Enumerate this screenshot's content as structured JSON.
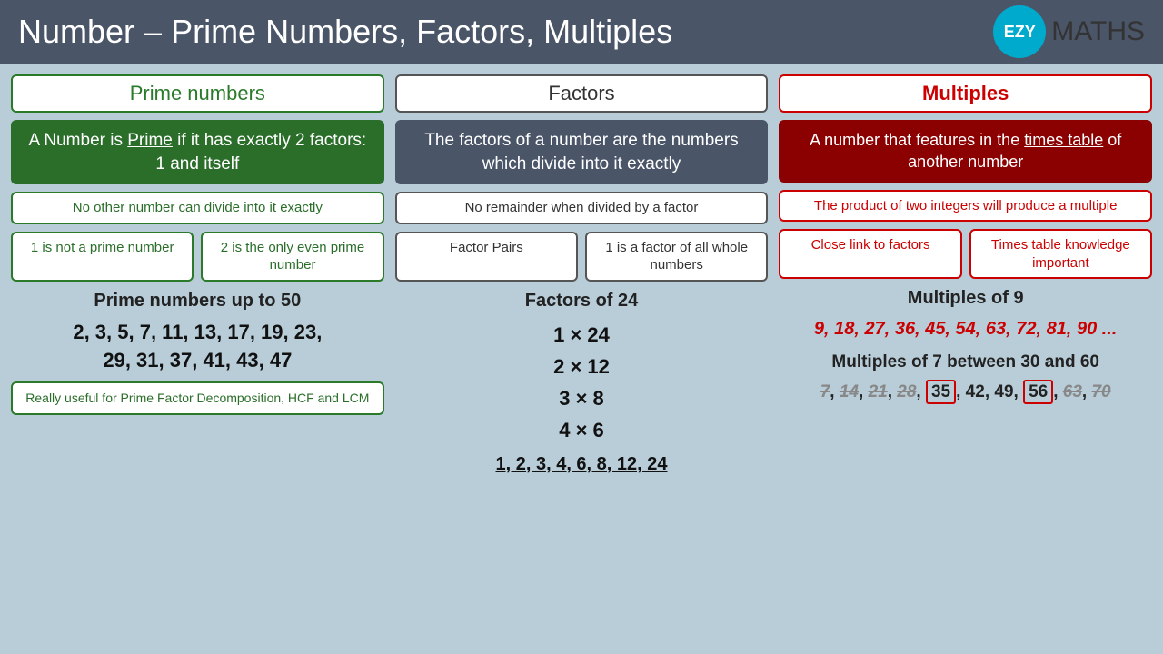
{
  "header": {
    "title": "Number – Prime Numbers, Factors, Multiples",
    "logo_text": "EZY",
    "logo_suffix": "MATHS"
  },
  "prime": {
    "section_title": "Prime numbers",
    "definition": "A Number is Prime if it has exactly 2 factors: 1 and itself",
    "sub_info": "No other number can divide into it exactly",
    "sub1_label": "1 is not a prime number",
    "sub2_label": "2 is the only even prime number",
    "list_label": "Prime numbers up to 50",
    "list": "2, 3, 5, 7, 11, 13, 17, 19, 23, 29, 31, 37, 41, 43, 47",
    "note": "Really useful for Prime Factor Decomposition, HCF and LCM"
  },
  "factors": {
    "section_title": "Factors",
    "definition": "The factors of a number are the numbers which divide into it exactly",
    "sub_info": "No remainder when divided by a factor",
    "sub1_label": "Factor Pairs",
    "sub2_label": "1 is a factor of all whole numbers",
    "list_label": "Factors of 24",
    "pairs": [
      "1 × 24",
      "2 × 12",
      "3 × 8",
      "4 × 6"
    ],
    "all_factors": "1, 2, 3, 4, 6, 8, 12, 24"
  },
  "multiples": {
    "section_title": "Multiples",
    "definition": "A number that features in the times table of another number",
    "sub_info": "The product of two integers will produce a multiple",
    "sub1_label": "Close link to factors",
    "sub2_label": "Times table knowledge important",
    "list_label": "Multiples of 9",
    "list": "9, 18, 27, 36, 45, 54, 63, 72, 81, 90 ...",
    "list2_label": "Multiples of 7 between 30 and 60",
    "list2": "7, 14, 21, 28, 35, 42, 49, 56, 63, 70"
  }
}
